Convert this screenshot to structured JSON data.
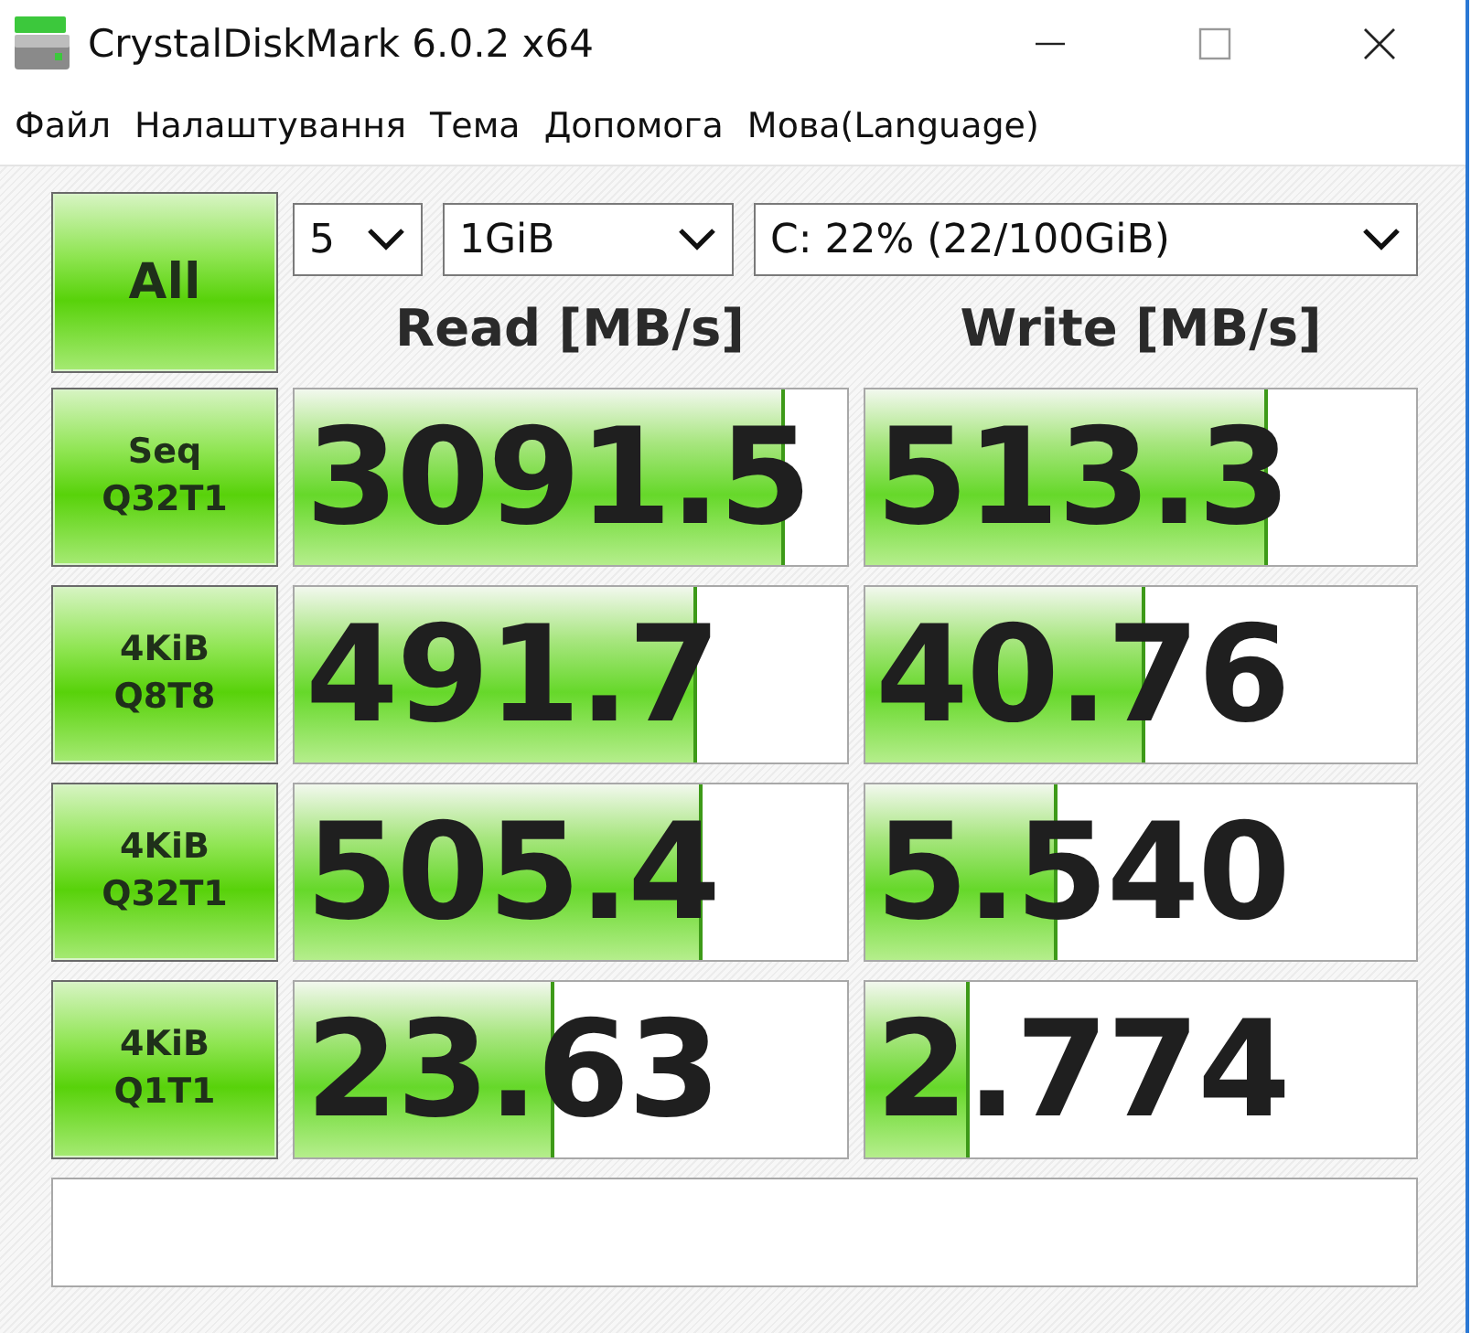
{
  "window": {
    "title": "CrystalDiskMark 6.0.2 x64"
  },
  "menu": [
    "Файл",
    "Налаштування",
    "Тема",
    "Допомога",
    "Мова(Language)"
  ],
  "all_button": {
    "label": "All"
  },
  "selects": [
    {
      "value": "5"
    },
    {
      "value": "1GiB"
    },
    {
      "value": "C: 22% (22/100GiB)"
    }
  ],
  "headers": [
    "Read [MB/s]",
    "Write [MB/s]"
  ],
  "rows": [
    {
      "label": "Seq\nQ32T1",
      "read": {
        "value": "3091.5",
        "level": 0.89
      },
      "write": {
        "value": "513.3",
        "level": 0.73
      }
    },
    {
      "label": "4KiB\nQ8T8",
      "read": {
        "value": "491.7",
        "level": 0.73
      },
      "write": {
        "value": "40.76",
        "level": 0.51
      }
    },
    {
      "label": "4KiB\nQ32T1",
      "read": {
        "value": "505.4",
        "level": 0.74
      },
      "write": {
        "value": "5.540",
        "level": 0.35
      }
    },
    {
      "label": "4KiB\nQ1T1",
      "read": {
        "value": "23.63",
        "level": 0.47
      },
      "write": {
        "value": "2.774",
        "level": 0.19
      }
    }
  ]
}
